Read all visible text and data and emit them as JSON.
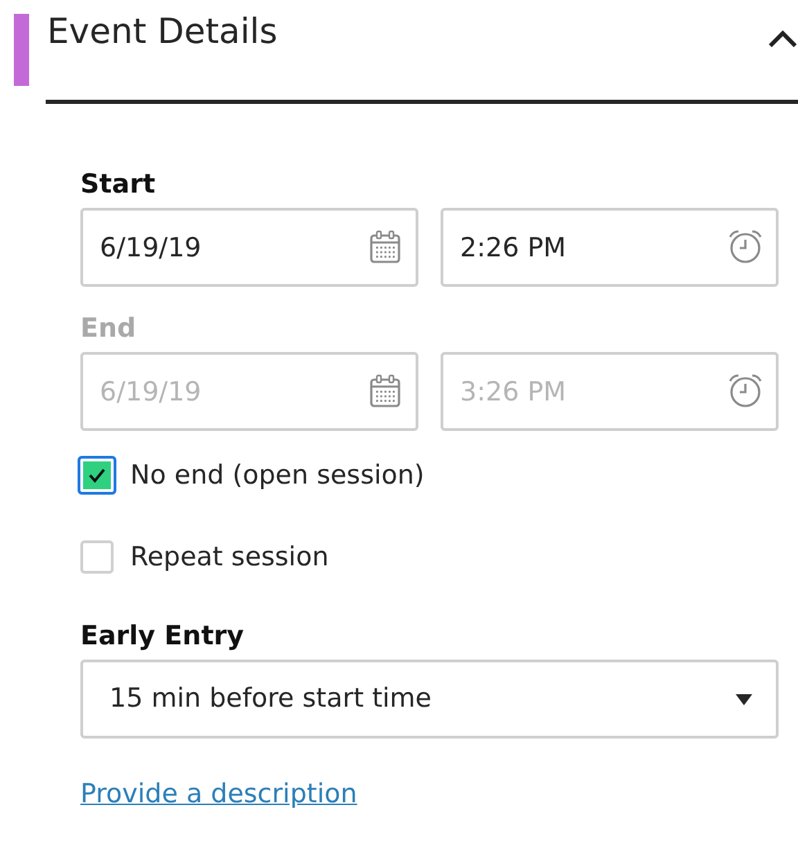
{
  "section": {
    "title": "Event Details",
    "expanded": true
  },
  "start": {
    "label": "Start",
    "date": "6/19/19",
    "time": "2:26 PM"
  },
  "end": {
    "label": "End",
    "disabled": true,
    "date": "6/19/19",
    "time": "3:26 PM"
  },
  "options": [
    {
      "label": "No end (open session)",
      "checked": true,
      "focused": true
    },
    {
      "label": "Repeat session",
      "checked": false,
      "focused": false
    }
  ],
  "early_entry": {
    "label": "Early Entry",
    "value": "15 min before start time"
  },
  "link": "Provide a description"
}
